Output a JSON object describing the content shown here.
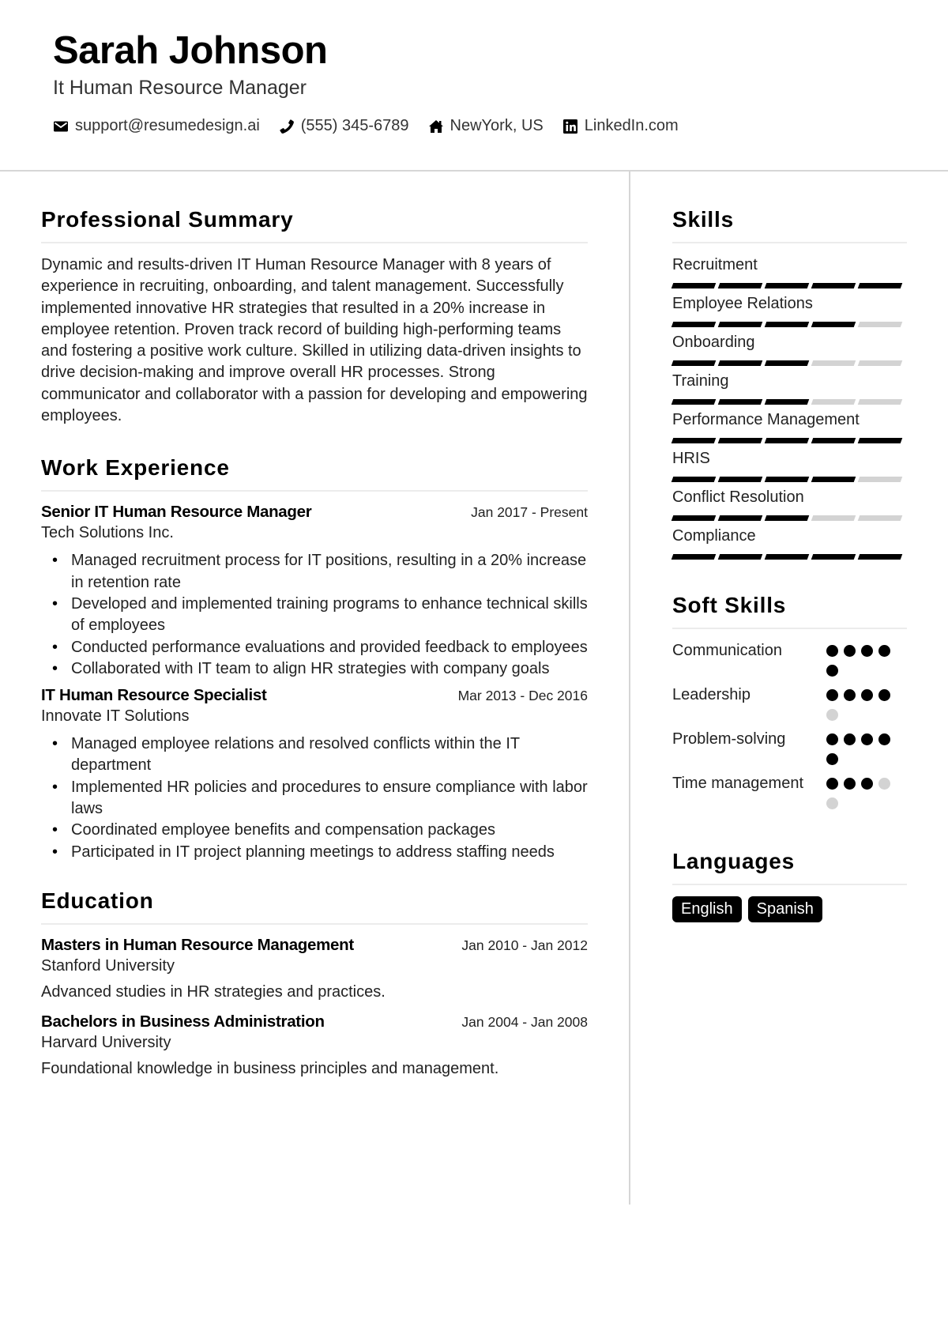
{
  "header": {
    "name": "Sarah Johnson",
    "role": "It Human Resource Manager",
    "contacts": [
      {
        "icon": "envelope-icon",
        "text": "support@resumedesign.ai"
      },
      {
        "icon": "phone-icon",
        "text": "(555) 345-6789"
      },
      {
        "icon": "home-icon",
        "text": "NewYork, US"
      },
      {
        "icon": "linkedin-icon",
        "text": "LinkedIn.com"
      }
    ]
  },
  "summary": {
    "title": "Professional Summary",
    "text": "Dynamic and results-driven IT Human Resource Manager with 8 years of experience in recruiting, onboarding, and talent management. Successfully implemented innovative HR strategies that resulted in a 20% increase in employee retention. Proven track record of building high-performing teams and fostering a positive work culture. Skilled in utilizing data-driven insights to drive decision-making and improve overall HR processes. Strong communicator and collaborator with a passion for developing and empowering employees."
  },
  "experience": {
    "title": "Work Experience",
    "jobs": [
      {
        "title": "Senior IT Human Resource Manager",
        "dates": "Jan 2017 - Present",
        "company": "Tech Solutions Inc.",
        "bullets": [
          "Managed recruitment process for IT positions, resulting in a 20% increase in retention rate",
          "Developed and implemented training programs to enhance technical skills of employees",
          "Conducted performance evaluations and provided feedback to employees",
          "Collaborated with IT team to align HR strategies with company goals"
        ]
      },
      {
        "title": "IT Human Resource Specialist",
        "dates": "Mar 2013 - Dec 2016",
        "company": "Innovate IT Solutions",
        "bullets": [
          "Managed employee relations and resolved conflicts within the IT department",
          "Implemented HR policies and procedures to ensure compliance with labor laws",
          "Coordinated employee benefits and compensation packages",
          "Participated in IT project planning meetings to address staffing needs"
        ]
      }
    ]
  },
  "education": {
    "title": "Education",
    "items": [
      {
        "degree": "Masters in Human Resource Management",
        "dates": "Jan 2010 - Jan 2012",
        "school": "Stanford University",
        "desc": "Advanced studies in HR strategies and practices."
      },
      {
        "degree": "Bachelors in Business Administration",
        "dates": "Jan 2004 - Jan 2008",
        "school": "Harvard University",
        "desc": "Foundational knowledge in business principles and management."
      }
    ]
  },
  "skills": {
    "title": "Skills",
    "max_level": 5,
    "items": [
      {
        "name": "Recruitment",
        "level": 5
      },
      {
        "name": "Employee Relations",
        "level": 4
      },
      {
        "name": "Onboarding",
        "level": 3
      },
      {
        "name": "Training",
        "level": 3
      },
      {
        "name": "Performance Management",
        "level": 5
      },
      {
        "name": "HRIS",
        "level": 4
      },
      {
        "name": "Conflict Resolution",
        "level": 3
      },
      {
        "name": "Compliance",
        "level": 5
      }
    ]
  },
  "soft_skills": {
    "title": "Soft Skills",
    "max_level": 5,
    "items": [
      {
        "name": "Communication",
        "level": 5
      },
      {
        "name": "Leadership",
        "level": 4
      },
      {
        "name": "Problem-solving",
        "level": 5
      },
      {
        "name": "Time management",
        "level": 3
      }
    ]
  },
  "languages": {
    "title": "Languages",
    "items": [
      "English",
      "Spanish"
    ]
  }
}
